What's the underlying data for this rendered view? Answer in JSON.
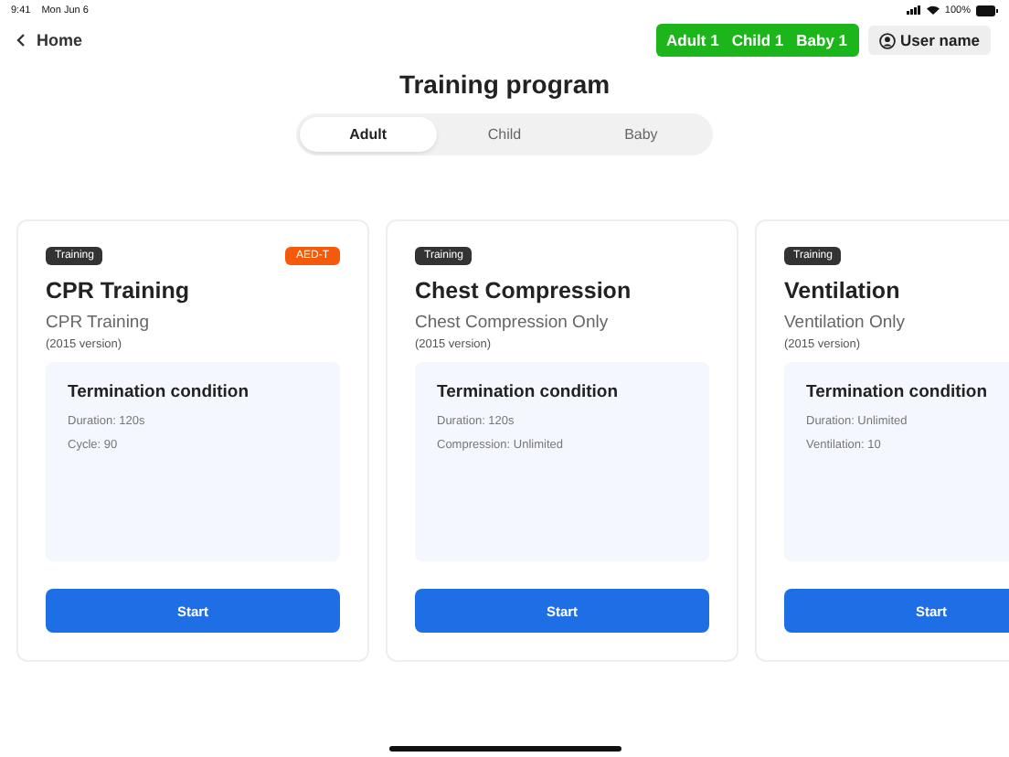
{
  "status_bar": {
    "time": "9:41",
    "date": "Mon Jun 6",
    "battery": "100%"
  },
  "header": {
    "back": "Home",
    "counts": [
      "Adult 1",
      "Child 1",
      "Baby 1"
    ],
    "user": "User name"
  },
  "title": "Training program",
  "tabs": [
    {
      "label": "Adult",
      "selected": true
    },
    {
      "label": "Child",
      "selected": false
    },
    {
      "label": "Baby",
      "selected": false
    }
  ],
  "cards": [
    {
      "tag": "Training",
      "badge": "AED-T",
      "title": "CPR Training",
      "subtitle": "CPR Training",
      "version": "(2015 version)",
      "condition_title": "Termination condition",
      "conditions": [
        "Duration: 120s",
        "Cycle: 90"
      ],
      "button": "Start"
    },
    {
      "tag": "Training",
      "title": "Chest Compression",
      "subtitle": "Chest Compression Only",
      "version": "(2015 version)",
      "condition_title": "Termination condition",
      "conditions": [
        "Duration: 120s",
        "Compression: Unlimited"
      ],
      "button": "Start"
    },
    {
      "tag": "Training",
      "title": "Ventilation",
      "subtitle": "Ventilation Only",
      "version": "(2015 version)",
      "condition_title": "Termination condition",
      "conditions": [
        "Duration: Unlimited",
        "Ventilation: 10"
      ],
      "button": "Start"
    }
  ]
}
